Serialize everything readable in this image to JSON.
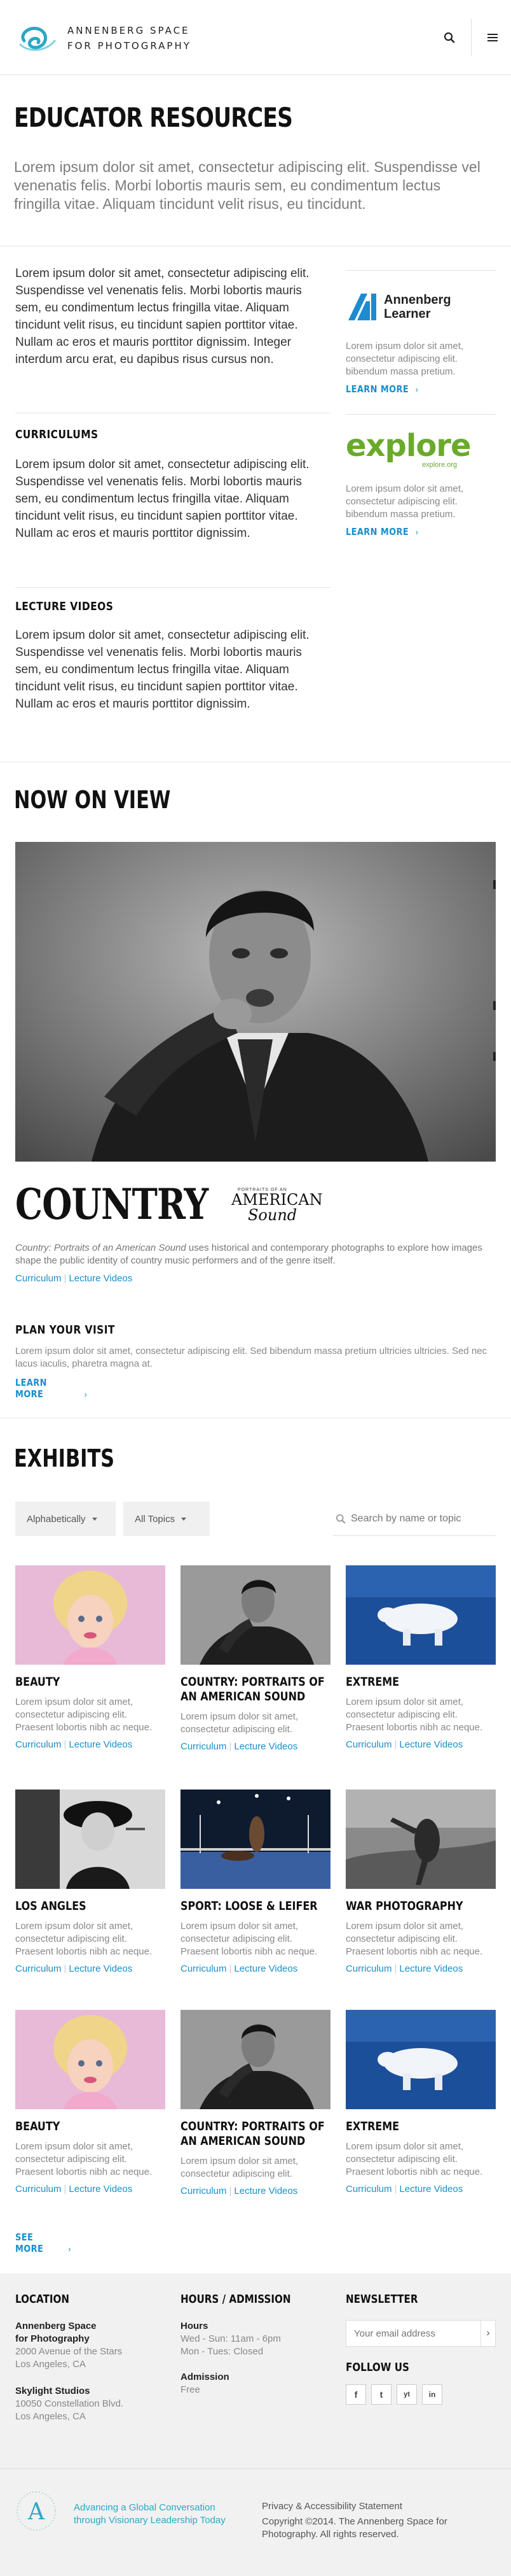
{
  "header": {
    "logo_line1": "ANNENBERG SPACE",
    "logo_line2": "FOR PHOTOGRAPHY",
    "search_icon": "search-icon",
    "menu_icon": "hamburger-menu-icon"
  },
  "page": {
    "title": "EDUCATOR RESOURCES",
    "intro": "Lorem ipsum dolor sit amet, consectetur adipiscing elit. Suspendisse vel venenatis felis. Morbi lobortis mauris sem, eu condimentum lectus fringilla vitae. Aliquam tincidunt velit risus, eu tincidunt."
  },
  "resources": {
    "intro_text": "Lorem ipsum dolor sit amet, consectetur adipiscing elit. Suspendisse vel venenatis felis. Morbi lobortis mauris sem, eu condimentum lectus fringilla vitae. Aliquam tincidunt velit risus, eu tincidunt sapien porttitor vitae. Nullam ac eros et mauris porttitor dignissim. Integer interdum arcu erat, eu dapibus risus cursus non.",
    "curriculums_heading": "CURRICULUMS",
    "curriculums_text": "Lorem ipsum dolor sit amet, consectetur adipiscing elit. Suspendisse vel venenatis felis. Morbi lobortis mauris sem, eu condimentum lectus fringilla vitae. Aliquam tincidunt velit risus, eu tincidunt sapien porttitor vitae. Nullam ac eros et mauris porttitor dignissim.",
    "lectures_heading": "LECTURE VIDEOS",
    "lectures_text": "Lorem ipsum dolor sit amet, consectetur adipiscing elit. Suspendisse vel venenatis felis. Morbi lobortis mauris sem, eu condimentum lectus fringilla vitae. Aliquam tincidunt velit risus, eu tincidunt sapien porttitor vitae. Nullam ac eros et mauris porttitor dignissim."
  },
  "sidebar": {
    "learner": {
      "logo_line1": "Annenberg",
      "logo_line2": "Learner",
      "text": "Lorem ipsum dolor sit amet, consectetur adipiscing elit. bibendum massa pretium.",
      "link": "LEARN MORE"
    },
    "explore": {
      "logo_word": "explore",
      "logo_sub": "explore.org",
      "text": "Lorem ipsum dolor sit amet, consectetur adipiscing elit. bibendum massa pretium.",
      "link": "LEARN MORE"
    }
  },
  "now_on_view": {
    "heading": "NOW ON VIEW",
    "logo_big": "COUNTRY",
    "logo_small": "PORTRAITS OF AN",
    "logo_american": "AMERICAN",
    "logo_sound": "Sound",
    "desc_title": "Country: Portraits of an American Sound",
    "desc_rest": " uses historical and contemporary photographs to explore how images shape the public identity of country music performers and of the genre itself.",
    "link_curriculum": "Curriculum",
    "link_lectures": "Lecture Videos",
    "plan_heading": "PLAN YOUR VISIT",
    "plan_text": "Lorem ipsum dolor sit amet, consectetur adipiscing elit. Sed bibendum massa pretium ultricies ultricies. Sed nec lacus iaculis, pharetra magna at.",
    "plan_link": "LEARN MORE"
  },
  "exhibits": {
    "heading": "EXHIBITS",
    "sort_label": "Alphabetically",
    "topic_label": "All Topics",
    "search_placeholder": "Search by name or topic",
    "see_more": "SEE MORE",
    "items": [
      {
        "title": "BEAUTY",
        "text": "Lorem ipsum dolor sit amet, consectetur adipiscing elit. Praesent lobortis nibh ac neque.",
        "l1": "Curriculum",
        "l2": "Lecture Videos"
      },
      {
        "title": "COUNTRY: PORTRAITS OF AN AMERICAN SOUND",
        "text": "Lorem ipsum dolor sit amet, consectetur adipiscing elit.",
        "l1": "Curriculum",
        "l2": "Lecture Videos"
      },
      {
        "title": "EXTREME",
        "text": "Lorem ipsum dolor sit amet, consectetur adipiscing elit. Praesent lobortis nibh ac neque.",
        "l1": "Curriculum",
        "l2": "Lecture Videos"
      },
      {
        "title": "LOS ANGLES",
        "text": "Lorem ipsum dolor sit amet, consectetur adipiscing elit. Praesent lobortis nibh ac neque.",
        "l1": "Curriculum",
        "l2": "Lecture Videos"
      },
      {
        "title": "SPORT: LOOSE & LEIFER",
        "text": "Lorem ipsum dolor sit amet, consectetur adipiscing elit. Praesent lobortis nibh ac neque.",
        "l1": "Curriculum",
        "l2": "Lecture Videos"
      },
      {
        "title": "WAR PHOTOGRAPHY",
        "text": "Lorem ipsum dolor sit amet, consectetur adipiscing elit. Praesent lobortis nibh ac neque.",
        "l1": "Curriculum",
        "l2": "Lecture Videos"
      },
      {
        "title": "BEAUTY",
        "text": "Lorem ipsum dolor sit amet, consectetur adipiscing elit. Praesent lobortis nibh ac neque.",
        "l1": "Curriculum",
        "l2": "Lecture Videos"
      },
      {
        "title": "COUNTRY: PORTRAITS OF AN AMERICAN SOUND",
        "text": "Lorem ipsum dolor sit amet, consectetur adipiscing elit.",
        "l1": "Curriculum",
        "l2": "Lecture Videos"
      },
      {
        "title": "EXTREME",
        "text": "Lorem ipsum dolor sit amet, consectetur adipiscing elit. Praesent lobortis nibh ac neque.",
        "l1": "Curriculum",
        "l2": "Lecture Videos"
      }
    ]
  },
  "footer": {
    "location_heading": "LOCATION",
    "venue1_name": "Annenberg Space for Photography",
    "venue1_addr1": "2000 Avenue of the Stars",
    "venue1_addr2": "Los Angeles, CA",
    "venue2_name": "Skylight Studios",
    "venue2_addr1": "10050 Constellation Blvd.",
    "venue2_addr2": "Los Angeles, CA",
    "hours_heading": "HOURS / ADMISSION",
    "hours_label": "Hours",
    "hours_line1": "Wed - Sun: 11am - 6pm",
    "hours_line2": "Mon - Tues: Closed",
    "admission_label": "Admission",
    "admission_value": "Free",
    "newsletter_heading": "NEWSLETTER",
    "newsletter_placeholder": "Your email address",
    "follow_heading": "FOLLOW US",
    "social": [
      "f",
      "t",
      "yt",
      "in"
    ],
    "tagline_line1": "Advancing a Global Conversation",
    "tagline_line2": "through Visionary Leadership Today",
    "privacy": "Privacy & Accessibility Statement",
    "copyright": "Copyright ©2014. The Annenberg Space for Photography. All rights reserved.",
    "accent_color": "#2aa8c5",
    "link_color": "#1a8fc9"
  }
}
